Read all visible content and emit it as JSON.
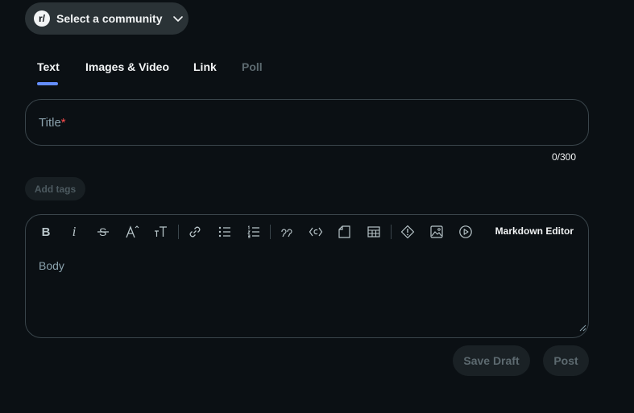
{
  "community": {
    "logo": "r/",
    "label": "Select a community",
    "icon": "chevron-down-icon"
  },
  "tabs": [
    {
      "label": "Text",
      "active": true
    },
    {
      "label": "Images & Video"
    },
    {
      "label": "Link"
    },
    {
      "label": "Poll",
      "disabled": true
    }
  ],
  "title": {
    "placeholder": "Title",
    "required_mark": "*",
    "counter": "0/300"
  },
  "tags": {
    "label": "Add tags"
  },
  "editor": {
    "toolbar": {
      "bold_glyph": "B",
      "italic_glyph": "i",
      "icons": [
        "bold-icon",
        "italic-icon",
        "strikethrough-icon",
        "superscript-icon",
        "heading-icon",
        "link-icon",
        "bullet-list-icon",
        "numbered-list-icon",
        "quote-icon",
        "code-icon",
        "code-block-icon",
        "table-icon",
        "spoiler-icon",
        "image-icon",
        "video-icon"
      ]
    },
    "markdown_label": "Markdown Editor",
    "body_placeholder": "Body"
  },
  "actions": {
    "save_draft": "Save Draft",
    "post": "Post"
  },
  "colors": {
    "accent": "#648efc",
    "background": "#0b1014",
    "required": "#ff4d4d"
  }
}
